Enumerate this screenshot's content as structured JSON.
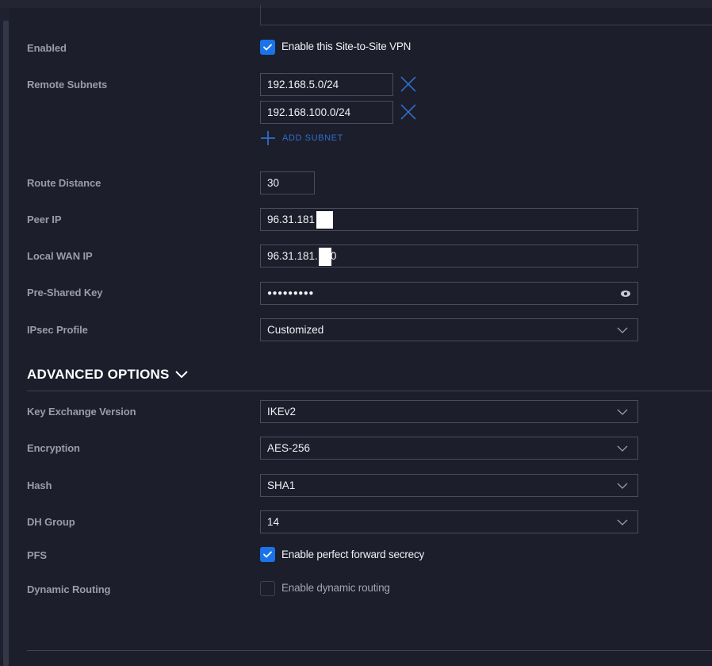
{
  "form": {
    "enabled": {
      "label": "Enabled",
      "checkbox_label": "Enable this Site-to-Site VPN",
      "checked": true
    },
    "remote_subnets": {
      "label": "Remote Subnets",
      "items": [
        "192.168.5.0/24",
        "192.168.100.0/24"
      ],
      "add_label": "ADD SUBNET",
      "remove_icon": "close-icon",
      "add_icon": "plus-icon"
    },
    "route_distance": {
      "label": "Route Distance",
      "value": "30"
    },
    "peer_ip": {
      "label": "Peer IP",
      "value": "96.31.181"
    },
    "local_wan_ip": {
      "label": "Local WAN IP",
      "value": "96.31.181.",
      "value_suffix": "0"
    },
    "pre_shared_key": {
      "label": "Pre-Shared Key",
      "value": "●●●●●●●●●",
      "reveal_icon": "eye-icon"
    },
    "ipsec_profile": {
      "label": "IPsec Profile",
      "value": "Customized"
    }
  },
  "advanced": {
    "title": "ADVANCED OPTIONS",
    "expanded": true,
    "key_exchange_version": {
      "label": "Key Exchange Version",
      "value": "IKEv2"
    },
    "encryption": {
      "label": "Encryption",
      "value": "AES-256"
    },
    "hash": {
      "label": "Hash",
      "value": "SHA1"
    },
    "dh_group": {
      "label": "DH Group",
      "value": "14"
    },
    "pfs": {
      "label": "PFS",
      "checkbox_label": "Enable perfect forward secrecy",
      "checked": true
    },
    "dynamic_routing": {
      "label": "Dynamic Routing",
      "checkbox_label": "Enable dynamic routing",
      "checked": false
    }
  },
  "colors": {
    "background": "#1c1e2b",
    "accent": "#1a73e8",
    "link": "#2f6ec9",
    "label": "#9a9ca8",
    "border": "#4a4d5e"
  }
}
